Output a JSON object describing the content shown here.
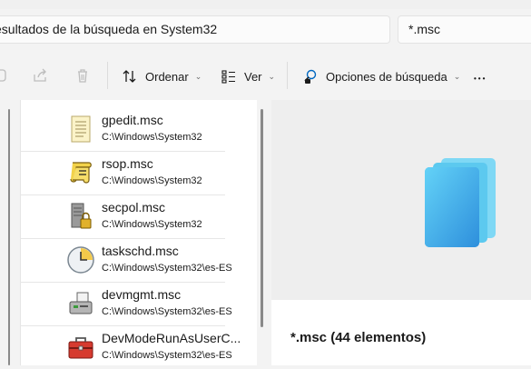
{
  "address": {
    "text": "esultados de la búsqueda en System32"
  },
  "search": {
    "text": "*.msc"
  },
  "toolbar": {
    "sort_label": "Ordenar",
    "view_label": "Ver",
    "search_options_label": "Opciones de búsqueda",
    "more_label": "•••"
  },
  "files": [
    {
      "name": "gpedit.msc",
      "path": "C:\\Windows\\System32",
      "icon": "notepad-icon"
    },
    {
      "name": "rsop.msc",
      "path": "C:\\Windows\\System32",
      "icon": "scroll-icon"
    },
    {
      "name": "secpol.msc",
      "path": "C:\\Windows\\System32",
      "icon": "server-lock-icon"
    },
    {
      "name": "taskschd.msc",
      "path": "C:\\Windows\\System32\\es-ES",
      "icon": "clock-icon"
    },
    {
      "name": "devmgmt.msc",
      "path": "C:\\Windows\\System32\\es-ES",
      "icon": "printer-icon"
    },
    {
      "name": "DevModeRunAsUserC...",
      "path": "C:\\Windows\\System32\\es-ES",
      "icon": "toolbox-icon"
    }
  ],
  "details": {
    "title": "*.msc (44 elementos)"
  },
  "colors": {
    "accent": "#0067c0",
    "stack_front": "#3aa7e6",
    "stack_back": "#55c7f0"
  }
}
